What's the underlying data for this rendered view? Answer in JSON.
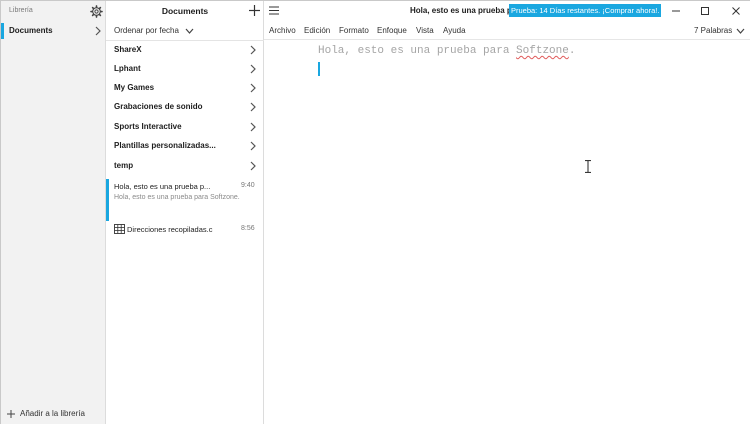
{
  "library": {
    "title": "Librería",
    "items": [
      {
        "label": "Documents"
      }
    ],
    "add_label": "Añadir a la librería"
  },
  "documents": {
    "title": "Documents",
    "sort_label": "Ordenar por fecha",
    "folders": [
      {
        "name": "ShareX"
      },
      {
        "name": "Lphant"
      },
      {
        "name": "My Games"
      },
      {
        "name": "Grabaciones de sonido"
      },
      {
        "name": "Sports Interactive"
      },
      {
        "name": "Plantillas personalizadas..."
      },
      {
        "name": "temp"
      }
    ],
    "files": [
      {
        "title": "Hola, esto es una prueba p...",
        "time": "9:40",
        "preview": "Hola, esto es una prueba para Softzone."
      },
      {
        "title": "Direcciones recopiladas.c",
        "time": "8:56"
      }
    ]
  },
  "editor": {
    "document_title": "Hola, esto es una prueba pa",
    "trial_banner": "Prueba: 14 Días restantes. ¡Comprar ahora!.",
    "menu": [
      "Archivo",
      "Edición",
      "Formato",
      "Enfoque",
      "Vista",
      "Ayuda"
    ],
    "word_count": "7 Palabras",
    "text_before": "Hola, esto es una prueba para ",
    "text_misspelled": "Softzone",
    "text_after": "."
  },
  "colors": {
    "accent": "#1aa7e0",
    "sidebar_bg": "#f2f2f2",
    "body_text": "#a5a5a5",
    "spellcheck": "#e05a5a"
  }
}
